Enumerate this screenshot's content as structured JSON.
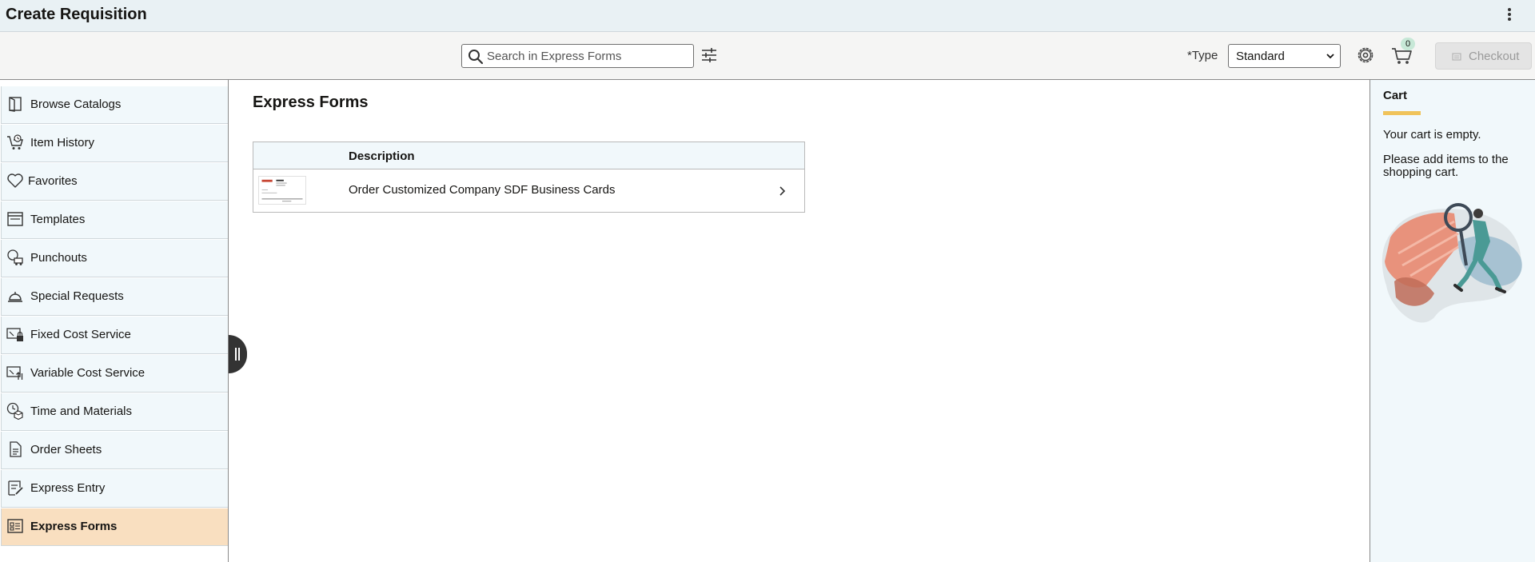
{
  "header": {
    "title": "Create Requisition",
    "more_icon": "kebab-vertical-icon"
  },
  "toolbar": {
    "search_placeholder": "Search in Express Forms",
    "type_label": "*Type",
    "type_value": "Standard",
    "cart_count": "0",
    "checkout_label": "Checkout"
  },
  "sidebar": {
    "items": [
      {
        "label": "Browse Catalogs",
        "icon": "book-icon"
      },
      {
        "label": "Item History",
        "icon": "cart-history-icon"
      },
      {
        "label": "Favorites",
        "icon": "heart-icon"
      },
      {
        "label": "Templates",
        "icon": "template-icon"
      },
      {
        "label": "Punchouts",
        "icon": "punchout-icon"
      },
      {
        "label": "Special Requests",
        "icon": "bell-icon"
      },
      {
        "label": "Fixed Cost Service",
        "icon": "fixed-cost-icon"
      },
      {
        "label": "Variable Cost Service",
        "icon": "variable-cost-icon"
      },
      {
        "label": "Time and Materials",
        "icon": "clock-box-icon"
      },
      {
        "label": "Order Sheets",
        "icon": "document-icon"
      },
      {
        "label": "Express Entry",
        "icon": "express-entry-icon"
      },
      {
        "label": "Express Forms",
        "icon": "express-forms-icon",
        "active": true
      }
    ]
  },
  "main": {
    "heading": "Express Forms",
    "table": {
      "header": "Description",
      "rows": [
        {
          "description": "Order Customized Company SDF Business Cards"
        }
      ]
    }
  },
  "cart": {
    "title": "Cart",
    "empty_text": "Your cart is empty.",
    "add_text": "Please add items to the shopping cart."
  },
  "colors": {
    "title_bar": "#e9f1f4",
    "sidebar_bg": "#f1f8fb",
    "active_item": "#f9dfc0",
    "accent_underline": "#f0c35a",
    "badge": "#c7e8d7"
  }
}
